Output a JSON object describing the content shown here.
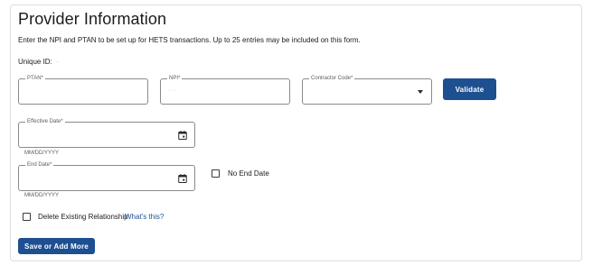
{
  "form": {
    "title": "Provider Information",
    "intro": "Enter the NPI and PTAN to be set up for HETS transactions. Up to 25 entries may be included on this form.",
    "unique_id_label": "Unique ID:",
    "unique_id_value": "·",
    "ptan": {
      "label": "PTAN*",
      "value": ""
    },
    "npi": {
      "label": "NPI*",
      "value": "·      ··"
    },
    "contractor_code": {
      "label": "Contractor Code*",
      "value": ""
    },
    "validate_label": "Validate",
    "effective_date": {
      "label": "Effective Date*",
      "value": "",
      "helper": "MM/DD/YYYY"
    },
    "end_date": {
      "label": "End Date*",
      "value": "",
      "helper": "MM/DD/YYYY"
    },
    "no_end_date_label": "No End Date",
    "delete_relationship_label": "Delete Existing Relationship",
    "whats_this_label": "What's this?",
    "save_label": "Save or Add More"
  },
  "colors": {
    "primary_button": "#1d4f91",
    "link": "#1d4f91",
    "border": "#8a8a8a"
  },
  "icons": {
    "calendar": "calendar-icon",
    "dropdown": "chevron-down-icon"
  }
}
